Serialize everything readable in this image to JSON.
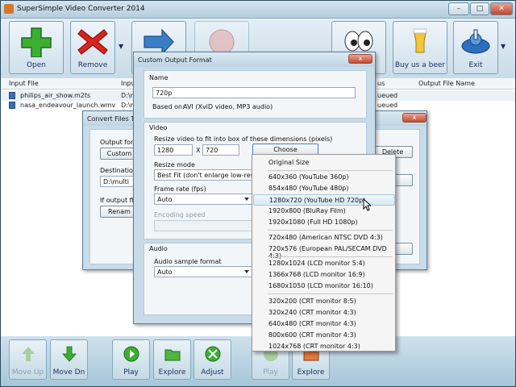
{
  "app": {
    "title": "SuperSimple Video Converter 2014"
  },
  "toolbar": {
    "open": "Open",
    "remove": "Remove",
    "buy_beer": "Buy us a beer",
    "exit": "Exit"
  },
  "list": {
    "headers": [
      "Input File",
      "Input",
      "us",
      "Output File Name"
    ],
    "rows": [
      {
        "name": "philips_air_show.m2ts",
        "input": "D:\\m",
        "status": "ueued"
      },
      {
        "name": "nasa_endeavour_launch.wmv",
        "input": "D:\\m",
        "status": "ueued"
      }
    ]
  },
  "bottom": {
    "move_up": "Move Up",
    "move_dn": "Move Dn",
    "play": "Play",
    "explore": "Explore",
    "adjust": "Adjust",
    "play2": "Play",
    "explore2": "Explore"
  },
  "convert_dialog": {
    "title": "Convert Files To...",
    "output_format_label": "Output form",
    "custom_button": "Custom",
    "delete_button": "Delete",
    "destination_label": "Destination f",
    "destination_value": "D:\\multi",
    "if_output_label": "If output file",
    "rename_button": "Renam",
    "close": "x"
  },
  "custom_dialog": {
    "title": "Custom Output Format",
    "name_section": "Name",
    "name_value": "720p",
    "based_on_label": "Based on:",
    "based_on_value": "AVI  (XviD video, MP3 audio)",
    "video_section": "Video",
    "resize_caption": "Resize video to fit into box of these dimensions (pixels)",
    "width": "1280",
    "x_label": "X",
    "height": "720",
    "choose_resolution": "Choose Resolution...",
    "resize_mode_label": "Resize mode",
    "resize_mode_value": "Best Fit  (don't enlarge low-resolutio",
    "frame_rate_label": "Frame rate (fps)",
    "frame_rate_value": "Auto",
    "encoding_speed_label": "Encoding speed",
    "audio_section": "Audio",
    "audio_rate_label": "Audio sample format",
    "audio_rate_value": "Auto",
    "close": "x"
  },
  "resolution_menu": {
    "items": [
      "Original Size",
      "640x360 (YouTube 360p)",
      "854x480 (YouTube 480p)",
      "1280x720 (YouTube HD 720p)",
      "1920x800 (BluRay Film)",
      "1920x1080 (Full HD 1080p)",
      "720x480 (American NTSC DVD 4:3)",
      "720x576 (European PAL/SECAM DVD 4:3)",
      "1280x1024 (LCD monitor 5:4)",
      "1366x768 (LCD monitor 16:9)",
      "1680x1050 (LCD monitor 16:10)",
      "320x200 (CRT monitor 8:5)",
      "320x240 (CRT monitor 4:3)",
      "640x480 (CRT monitor 4:3)",
      "800x600 (CRT monitor 4:3)",
      "1024x768 (CRT monitor 4:3)"
    ],
    "highlighted": "1280x720 (YouTube HD 720p)"
  },
  "colors": {
    "accent": "#3a7fc4",
    "window_bg": "#c7dbe9",
    "close_red": "#c4452b"
  },
  "icons": [
    "app-icon",
    "plus-icon",
    "x-icon",
    "arrow-right-icon",
    "eyes-icon",
    "beer-icon",
    "exit-icon",
    "file-icon",
    "up-arrow-icon",
    "down-arrow-icon",
    "play-icon",
    "folder-icon",
    "adjust-icon"
  ]
}
